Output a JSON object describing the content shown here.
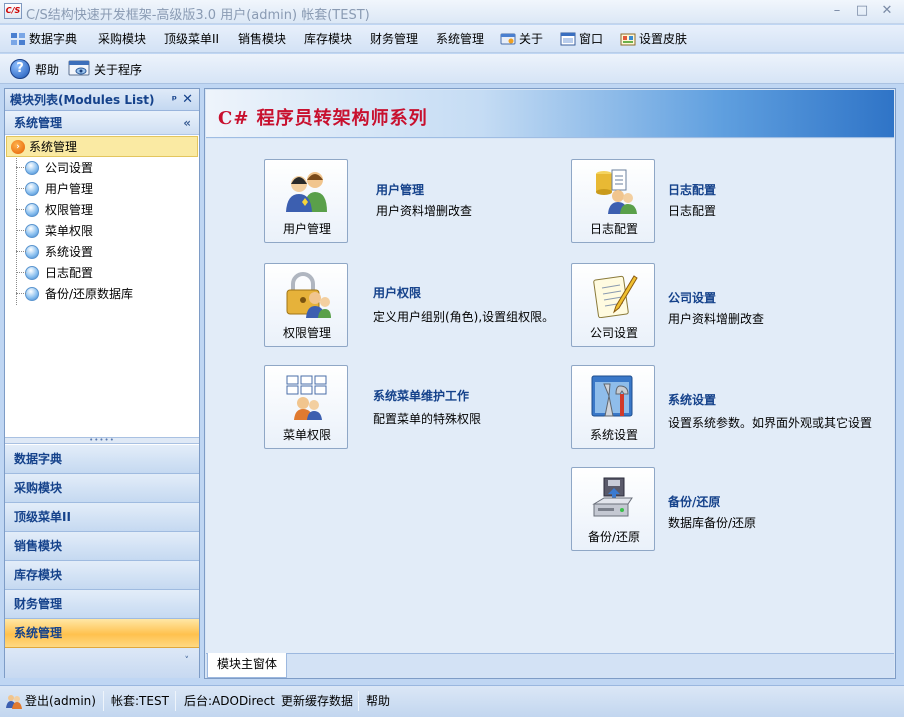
{
  "window": {
    "title": "C/S结构快速开发框架-高级版3.0 用户(admin) 帐套(TEST)",
    "icon_text": "C/S",
    "controls": [
      "–",
      "□",
      "✕"
    ]
  },
  "menubar": {
    "items": [
      {
        "label": "数据字典",
        "icon": "dictionary-icon"
      },
      {
        "label": "采购模块"
      },
      {
        "label": "顶级菜单II"
      },
      {
        "label": "销售模块"
      },
      {
        "label": "库存模块"
      },
      {
        "label": "财务管理"
      },
      {
        "label": "系统管理"
      },
      {
        "label": "关于",
        "icon": "about-icon"
      },
      {
        "label": "窗口",
        "icon": "window-icon"
      },
      {
        "label": "设置皮肤",
        "icon": "skin-icon"
      }
    ]
  },
  "toolbar": {
    "help_label": "帮助",
    "help_glyph": "?",
    "about_label": "关于程序"
  },
  "left_panel": {
    "title": "模块列表(Modules List)",
    "pin_glyph": "ᵖ",
    "close_glyph": "✕",
    "group_title": "系统管理",
    "collapse_glyph": "«",
    "tree_root": "系统管理",
    "tree_items": [
      "公司设置",
      "用户管理",
      "权限管理",
      "菜单权限",
      "系统设置",
      "日志配置",
      "备份/还原数据库"
    ],
    "splitter_glyph": "•••••",
    "nav_buttons": [
      "数据字典",
      "采购模块",
      "顶级菜单II",
      "销售模块",
      "库存模块",
      "财务管理",
      "系统管理"
    ],
    "active_nav": "系统管理",
    "footer_glyph": "˅"
  },
  "main": {
    "banner_title": "C# 程序员转架构师系列",
    "tiles": [
      {
        "label": "用户管理",
        "title": "用户管理",
        "desc": "用户资料增删改查",
        "icon": "users-icon"
      },
      {
        "label": "日志配置",
        "title": "日志配置",
        "desc": "日志配置",
        "icon": "log-config-icon"
      },
      {
        "label": "权限管理",
        "title": "用户权限",
        "desc": "定义用户组别(角色),设置组权限。",
        "icon": "lock-users-icon"
      },
      {
        "label": "公司设置",
        "title": "公司设置",
        "desc": "用户资料增删改查",
        "icon": "notepad-icon"
      },
      {
        "label": "菜单权限",
        "title": "系统菜单维护工作",
        "desc": "配置菜单的特殊权限",
        "icon": "menu-permission-icon"
      },
      {
        "label": "系统设置",
        "title": "系统设置",
        "desc": "设置系统参数。如界面外观或其它设置",
        "icon": "tools-icon"
      },
      {
        "label": "备份/还原",
        "title": "备份/还原",
        "desc": "数据库备份/还原",
        "icon": "backup-drive-icon"
      }
    ],
    "tab_label": "模块主窗体"
  },
  "statusbar": {
    "logout": "登出(admin)",
    "account": "帐套:TEST",
    "backend": "后台:ADODirect",
    "refresh_cache": "更新缓存数据",
    "help": "帮助"
  },
  "colors": {
    "banner_title": "#c8102e",
    "active_nav": "#ffc14e",
    "tree_selected": "#faeaa3",
    "link_blue": "#15428b"
  }
}
